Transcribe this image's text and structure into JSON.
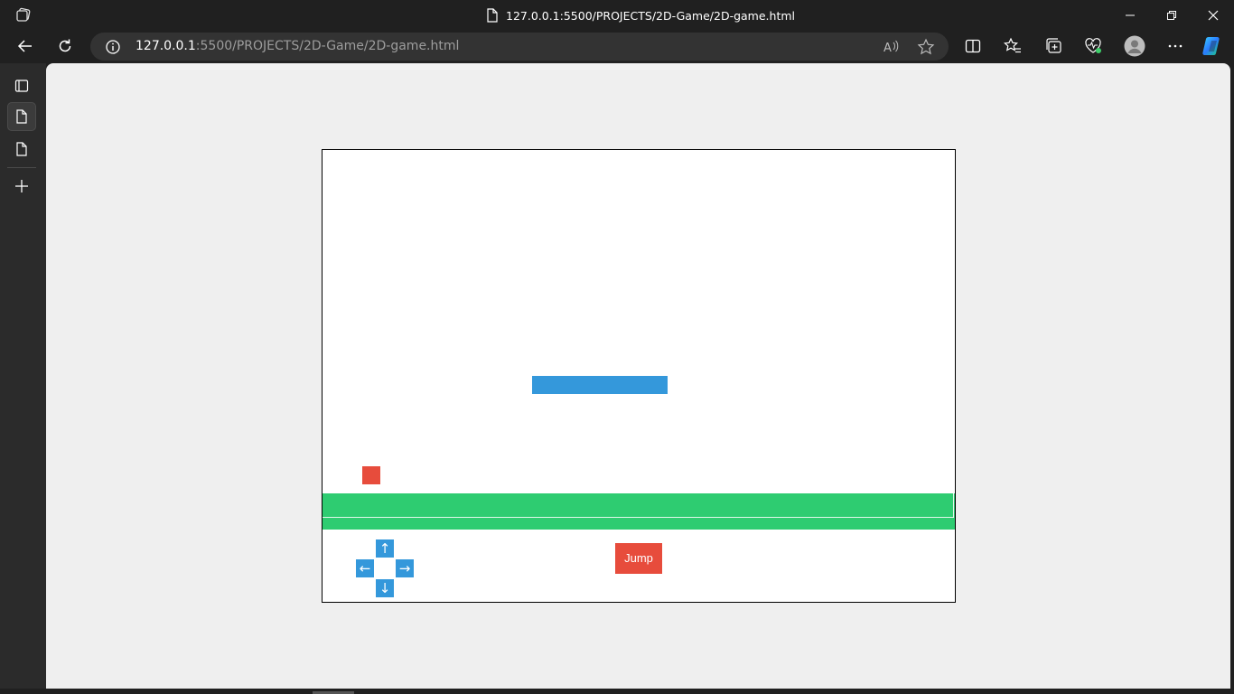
{
  "window": {
    "title": "127.0.0.1:5500/PROJECTS/2D-Game/2D-game.html",
    "app_icon": "edge-workspaces-icon",
    "controls": [
      "minimize-icon",
      "restore-icon",
      "close-icon"
    ]
  },
  "toolbar": {
    "back_icon": "back-arrow-icon",
    "refresh_icon": "refresh-icon",
    "address": {
      "host": "127.0.0.1",
      "rest": ":5500/PROJECTS/2D-Game/2D-game.html",
      "info_icon": "info-icon"
    },
    "right_icons": [
      "read-aloud-icon",
      "favorite-star-icon",
      "split-screen-icon",
      "favorites-icon",
      "collections-icon",
      "browser-essentials-icon",
      "profile-avatar-icon",
      "more-options-icon",
      "copilot-icon"
    ]
  },
  "sidebar": {
    "items": [
      "tab-actions-icon",
      "page-tab-icon",
      "page-tab-icon",
      "new-tab-plus-icon"
    ]
  },
  "game": {
    "controls": {
      "up": "↑",
      "left": "←",
      "right": "→",
      "down": "↓"
    },
    "jump_label": "Jump",
    "colors": {
      "platform": "#3498db",
      "player": "#e74c3c",
      "ground": "#2ecc71",
      "controls": "#3498db",
      "jump": "#e74c3c"
    }
  }
}
